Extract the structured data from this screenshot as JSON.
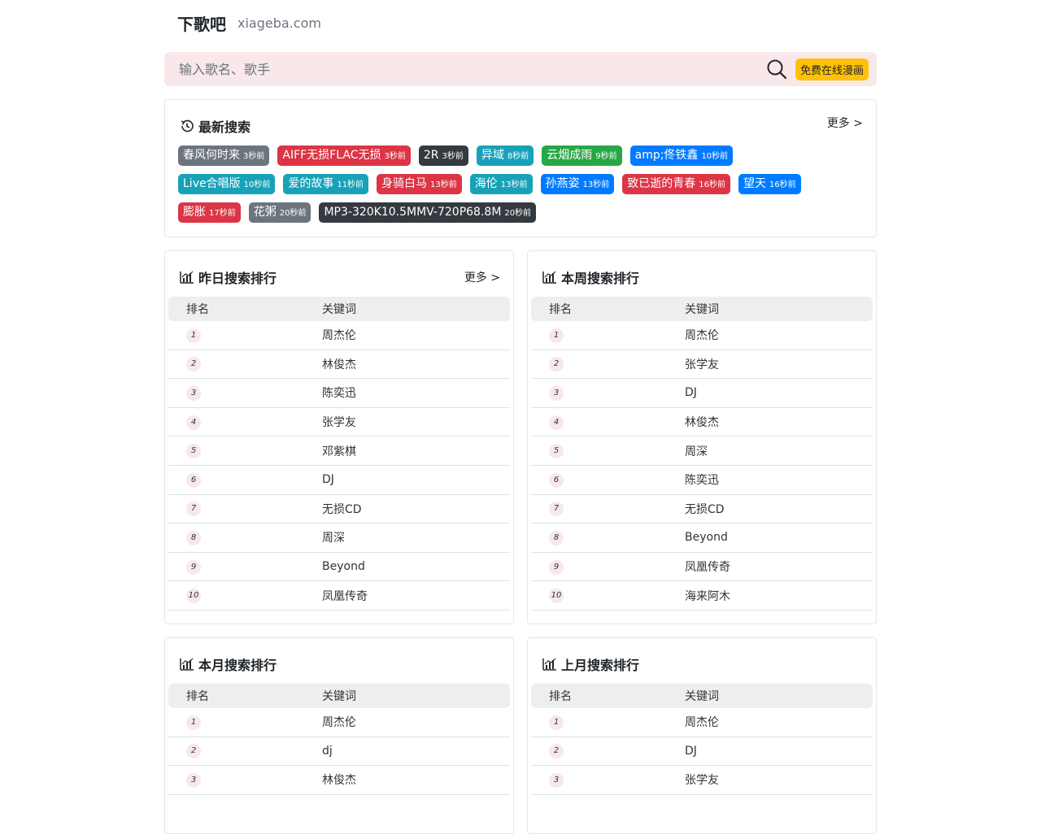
{
  "header": {
    "logo": "下歌吧",
    "domain": "xiageba.com"
  },
  "search": {
    "placeholder": "输入歌名、歌手",
    "comic_button": "免费在线漫画"
  },
  "latest": {
    "title": "最新搜索",
    "more": "更多 >",
    "tags": [
      {
        "label": "春风何时来",
        "ago": "3秒前",
        "color": "#6c757d"
      },
      {
        "label": "AIFF无损FLAC无损",
        "ago": "3秒前",
        "color": "#dc3545"
      },
      {
        "label": "2R",
        "ago": "3秒前",
        "color": "#343a40"
      },
      {
        "label": "异域",
        "ago": "8秒前",
        "color": "#17a2b8"
      },
      {
        "label": "云烟成雨",
        "ago": "9秒前",
        "color": "#28a745"
      },
      {
        "label": "amp;佟铁鑫",
        "ago": "10秒前",
        "color": "#007bff"
      },
      {
        "label": "Live合唱版",
        "ago": "10秒前",
        "color": "#17a2b8"
      },
      {
        "label": "爱的故事",
        "ago": "11秒前",
        "color": "#17a2b8"
      },
      {
        "label": "身骑白马",
        "ago": "13秒前",
        "color": "#dc3545"
      },
      {
        "label": "海伦",
        "ago": "13秒前",
        "color": "#17a2b8"
      },
      {
        "label": "孙燕姿",
        "ago": "13秒前",
        "color": "#007bff"
      },
      {
        "label": "致已逝的青春",
        "ago": "16秒前",
        "color": "#dc3545"
      },
      {
        "label": "望天",
        "ago": "16秒前",
        "color": "#007bff"
      },
      {
        "label": "膨胀",
        "ago": "17秒前",
        "color": "#dc3545"
      },
      {
        "label": "花粥",
        "ago": "20秒前",
        "color": "#6c757d"
      },
      {
        "label": "MP3-320K10.5MMV-720P68.8M",
        "ago": "20秒前",
        "color": "#343a40"
      }
    ]
  },
  "table_headers": {
    "rank": "排名",
    "keyword": "关键词"
  },
  "yesterday": {
    "title": "昨日搜索排行",
    "more": "更多 >",
    "rows": [
      {
        "rank": "1",
        "keyword": "周杰伦"
      },
      {
        "rank": "2",
        "keyword": "林俊杰"
      },
      {
        "rank": "3",
        "keyword": "陈奕迅"
      },
      {
        "rank": "4",
        "keyword": "张学友"
      },
      {
        "rank": "5",
        "keyword": "邓紫棋"
      },
      {
        "rank": "6",
        "keyword": "DJ"
      },
      {
        "rank": "7",
        "keyword": "无损CD"
      },
      {
        "rank": "8",
        "keyword": "周深"
      },
      {
        "rank": "9",
        "keyword": "Beyond"
      },
      {
        "rank": "10",
        "keyword": "凤凰传奇"
      }
    ]
  },
  "week": {
    "title": "本周搜索排行",
    "rows": [
      {
        "rank": "1",
        "keyword": "周杰伦"
      },
      {
        "rank": "2",
        "keyword": "张学友"
      },
      {
        "rank": "3",
        "keyword": "DJ"
      },
      {
        "rank": "4",
        "keyword": "林俊杰"
      },
      {
        "rank": "5",
        "keyword": "周深"
      },
      {
        "rank": "6",
        "keyword": "陈奕迅"
      },
      {
        "rank": "7",
        "keyword": "无损CD"
      },
      {
        "rank": "8",
        "keyword": "Beyond"
      },
      {
        "rank": "9",
        "keyword": "凤凰传奇"
      },
      {
        "rank": "10",
        "keyword": "海来阿木"
      }
    ]
  },
  "month": {
    "title": "本月搜索排行",
    "rows": [
      {
        "rank": "1",
        "keyword": "周杰伦"
      },
      {
        "rank": "2",
        "keyword": "dj"
      },
      {
        "rank": "3",
        "keyword": "林俊杰"
      }
    ]
  },
  "last_month": {
    "title": "上月搜索排行",
    "rows": [
      {
        "rank": "1",
        "keyword": "周杰伦"
      },
      {
        "rank": "2",
        "keyword": "DJ"
      },
      {
        "rank": "3",
        "keyword": "张学友"
      }
    ]
  }
}
